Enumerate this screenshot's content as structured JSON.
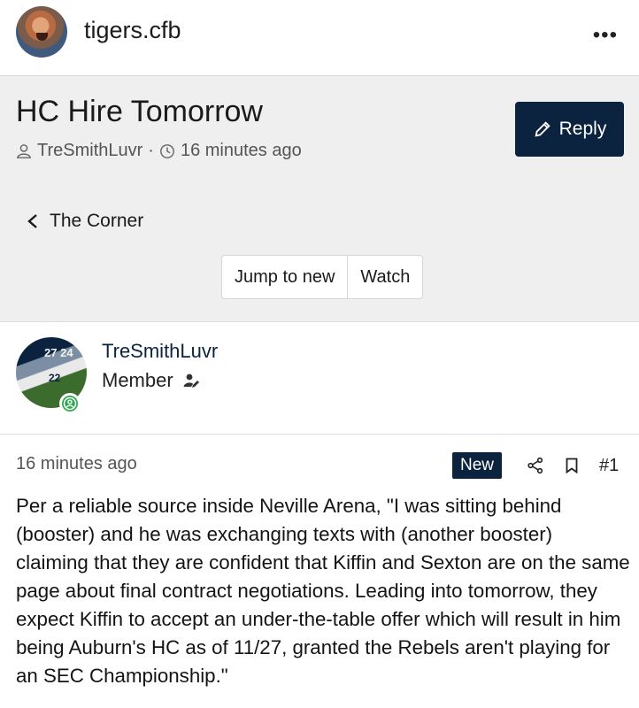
{
  "site": {
    "handle": "tigers.cfb",
    "more_icon": "more-horizontal-icon"
  },
  "thread": {
    "title": "HC Hire Tomorrow",
    "author": "TreSmithLuvr",
    "separator": "·",
    "time": "16 minutes ago",
    "reply_label": "Reply",
    "breadcrumb": "The Corner",
    "jump_label": "Jump to new",
    "watch_label": "Watch"
  },
  "post": {
    "author": "TreSmithLuvr",
    "role": "Member",
    "jersey_numbers": [
      "27",
      "24",
      "22"
    ],
    "time": "16 minutes ago",
    "badge": "New",
    "number": "#1",
    "body": "Per a reliable source inside Neville Arena, \"I was sitting behind (booster) and he was exchanging texts with (another booster) claiming that they are confident that Kiffin and Sexton are on the same page about final contract negotiations. Leading into tomorrow, they expect Kiffin to accept an under-the-table offer which will result in him being Auburn's HC as of 11/27, granted the Rebels aren't playing for an SEC Championship.\""
  },
  "colors": {
    "navy": "#0c2340",
    "online": "#2fa84f",
    "header_bg": "#efefef"
  }
}
